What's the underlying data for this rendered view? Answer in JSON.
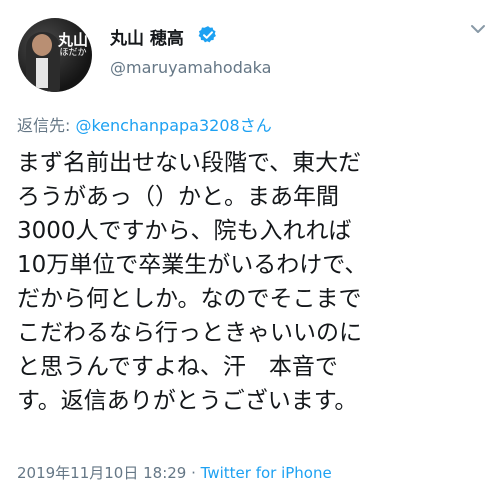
{
  "user": {
    "display_name": "丸山 穂高",
    "handle": "@maruyamahodaka",
    "avatar_logo_main": "丸山",
    "avatar_logo_sub": "ほだか"
  },
  "reply": {
    "prefix": "返信先: ",
    "mention": "@kenchanpapa3208さん"
  },
  "tweet": {
    "text": "まず名前出せない段階で、東大だ\nろうがあっ（）かと。まあ年間\n3000人ですから、院も入れれば\n10万単位で卒業生がいるわけで、\nだから何としか。なのでそこまで\nこだわるなら行っときゃいいのに\nと思うんですよね、汗　本音で\nす。返信ありがとうございます。"
  },
  "meta": {
    "timestamp": "2019年11月10日 18:29",
    "separator": " · ",
    "source": "Twitter for iPhone"
  },
  "icons": {
    "verified": "verified-badge-icon",
    "caret": "chevron-down-icon"
  },
  "colors": {
    "accent": "#1da1f2",
    "secondary_text": "#657786",
    "primary_text": "#14171a"
  }
}
